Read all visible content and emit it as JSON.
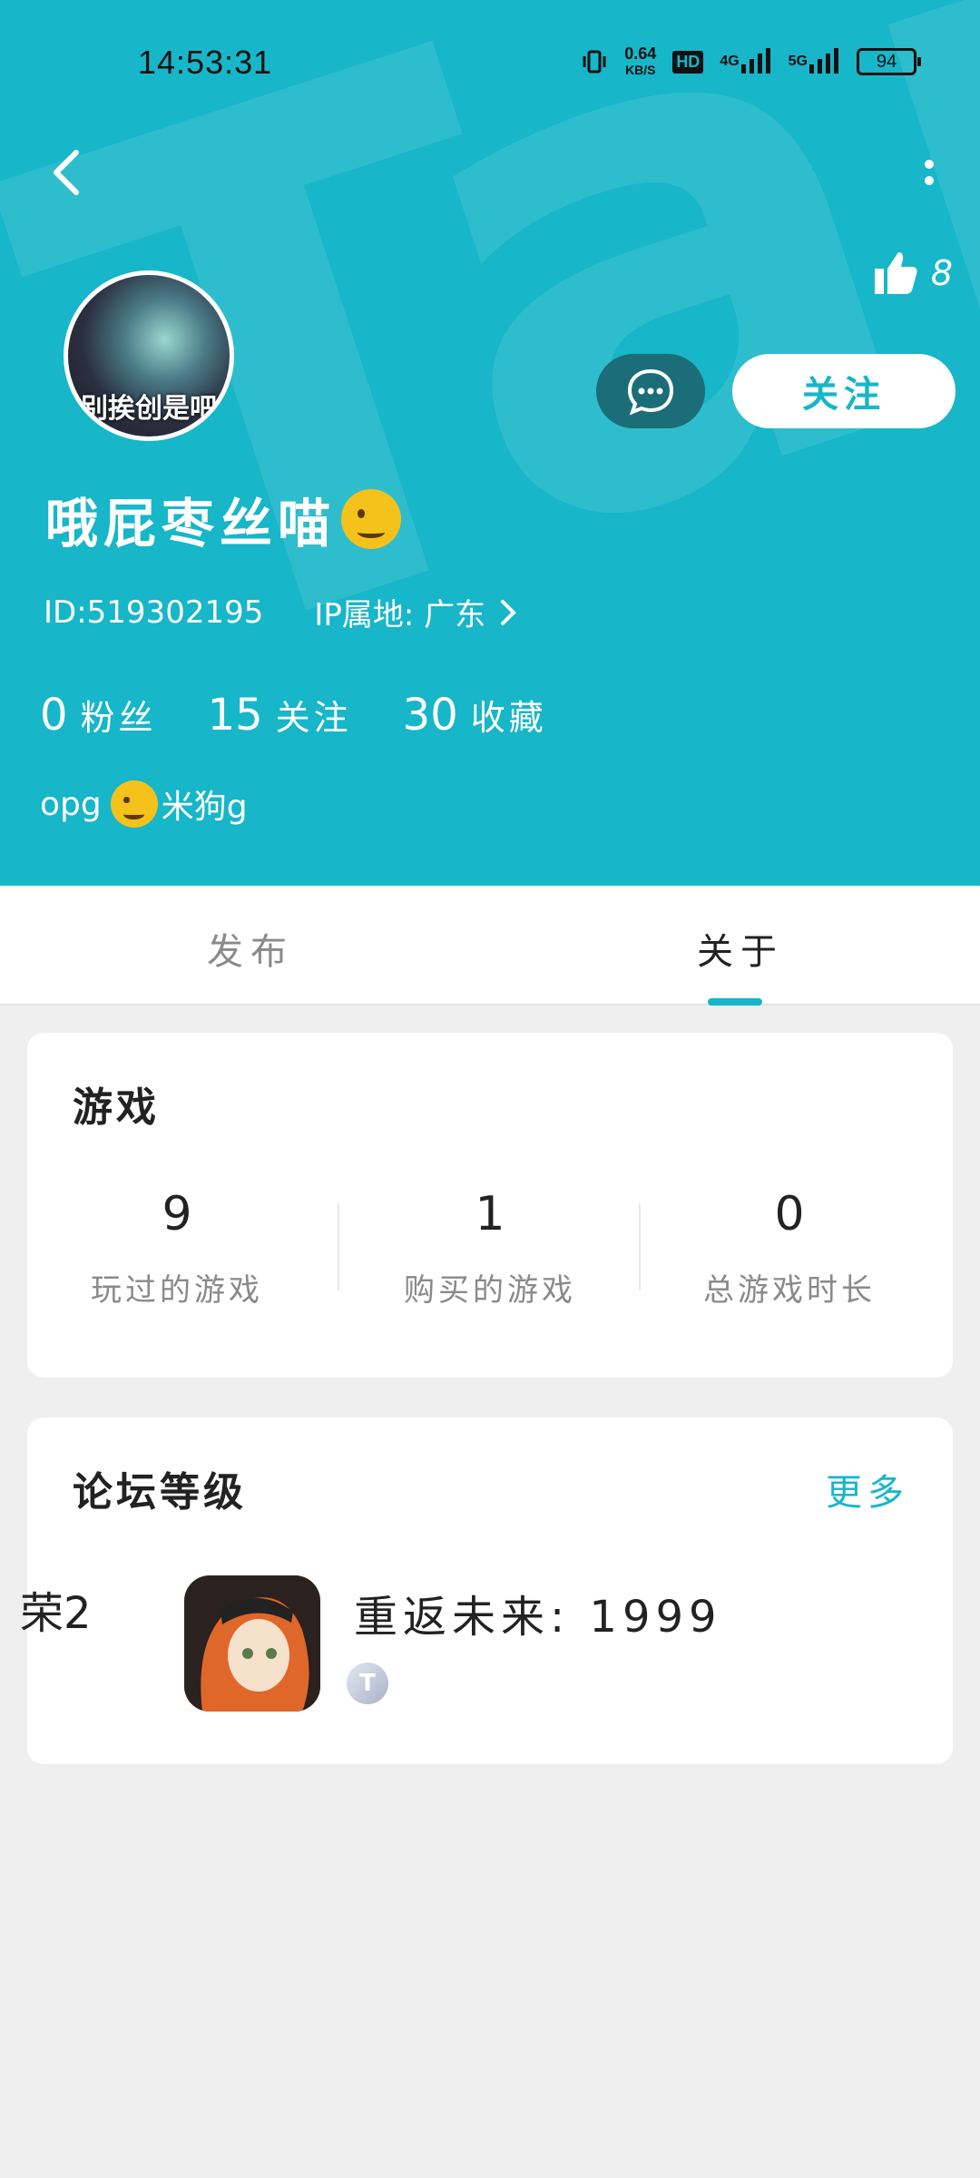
{
  "status_bar": {
    "time": "14:53:31",
    "speed_value": "0.64",
    "speed_unit": "KB/S",
    "hd": "HD",
    "net1": "4G",
    "net2": "5G",
    "battery": "94"
  },
  "profile": {
    "likes": "8",
    "avatar_caption": "别挨创是吧",
    "follow_label": "关注",
    "name": "哦屁枣丝喵",
    "user_id": "ID:519302195",
    "ip_location": "IP属地: 广东",
    "stats": [
      {
        "num": "0",
        "label": "粉丝"
      },
      {
        "num": "15",
        "label": "关注"
      },
      {
        "num": "30",
        "label": "收藏"
      }
    ],
    "bio_prefix": "opg",
    "bio_suffix": "米狗g"
  },
  "tabs": [
    {
      "label": "发布"
    },
    {
      "label": "关于"
    }
  ],
  "game_card": {
    "title": "游戏",
    "stats": [
      {
        "value": "9",
        "label": "玩过的游戏"
      },
      {
        "value": "1",
        "label": "购买的游戏"
      },
      {
        "value": "0",
        "label": "总游戏时长"
      }
    ]
  },
  "forum_card": {
    "title": "论坛等级",
    "more_label": "更多",
    "level_label": "荣2",
    "game_name": "重返未来: 1999",
    "badge": "T"
  },
  "colors": {
    "accent": "#17b6c8",
    "message_button": "#1b6d78"
  }
}
